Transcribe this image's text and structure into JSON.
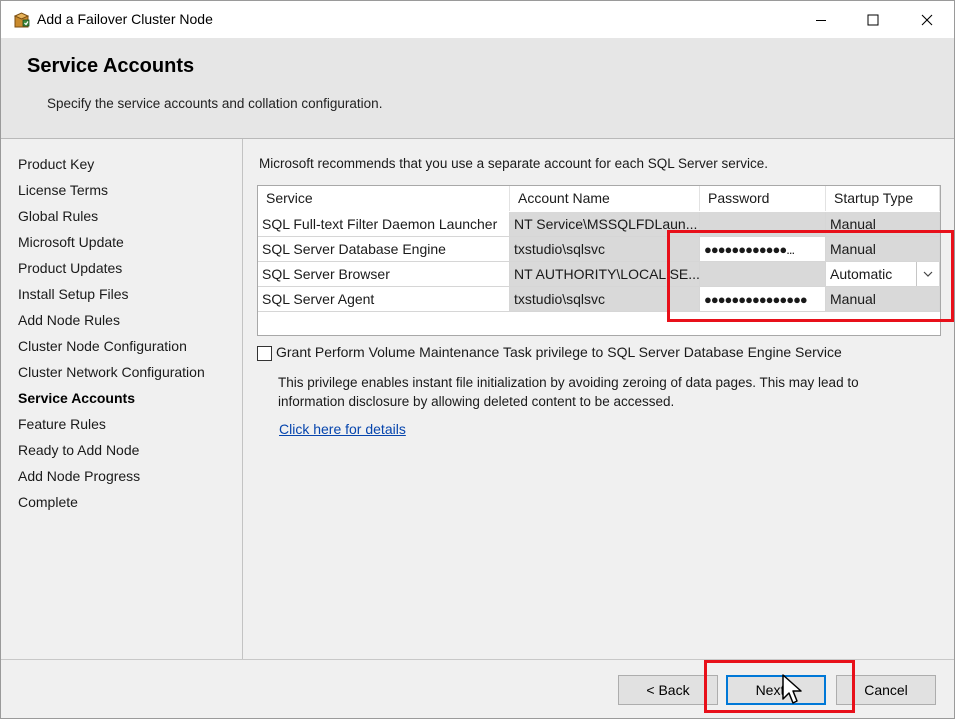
{
  "window": {
    "title": "Add a Failover Cluster Node",
    "icon": "setup-box-icon",
    "controls": {
      "minimize": "minimize-icon",
      "maximize": "maximize-icon",
      "close": "close-icon"
    }
  },
  "header": {
    "title": "Service Accounts",
    "subtitle": "Specify the service accounts and collation configuration."
  },
  "nav": {
    "items": [
      {
        "label": "Product Key"
      },
      {
        "label": "License Terms"
      },
      {
        "label": "Global Rules"
      },
      {
        "label": "Microsoft Update"
      },
      {
        "label": "Product Updates"
      },
      {
        "label": "Install Setup Files"
      },
      {
        "label": "Add Node Rules"
      },
      {
        "label": "Cluster Node Configuration"
      },
      {
        "label": "Cluster Network Configuration"
      },
      {
        "label": "Service Accounts",
        "active": true
      },
      {
        "label": "Feature Rules"
      },
      {
        "label": "Ready to Add Node"
      },
      {
        "label": "Add Node Progress"
      },
      {
        "label": "Complete"
      }
    ]
  },
  "main": {
    "intro": "Microsoft recommends that you use a separate account for each SQL Server service.",
    "table": {
      "columns": [
        "Service",
        "Account Name",
        "Password",
        "Startup Type"
      ],
      "rows": [
        {
          "service": "SQL Full-text Filter Daemon Launcher",
          "account": "NT Service\\MSSQLFDLaun...",
          "password": "",
          "startup": "Manual"
        },
        {
          "service": "SQL Server Database Engine",
          "account": "txstudio\\sqlsvc",
          "password": "●●●●●●●●●●●●...",
          "startup": "Manual"
        },
        {
          "service": "SQL Server Browser",
          "account": "NT AUTHORITY\\LOCAL SE...",
          "password": "",
          "startup": "Automatic"
        },
        {
          "service": "SQL Server Agent",
          "account": "txstudio\\sqlsvc",
          "password": "●●●●●●●●●●●●●●●",
          "startup": "Manual"
        }
      ]
    },
    "checkbox_label": "Grant Perform Volume Maintenance Task privilege to SQL Server Database Engine Service",
    "checkbox_checked": false,
    "note": "This privilege enables instant file initialization by avoiding zeroing of data pages. This may lead to information disclosure by allowing deleted content to be accessed.",
    "link": "Click here for details"
  },
  "footer": {
    "back": "< Back",
    "next": "Next >",
    "cancel": "Cancel"
  },
  "colors": {
    "highlight": "#e8101a",
    "link": "#0645ad",
    "focus_border": "#0078d7"
  }
}
